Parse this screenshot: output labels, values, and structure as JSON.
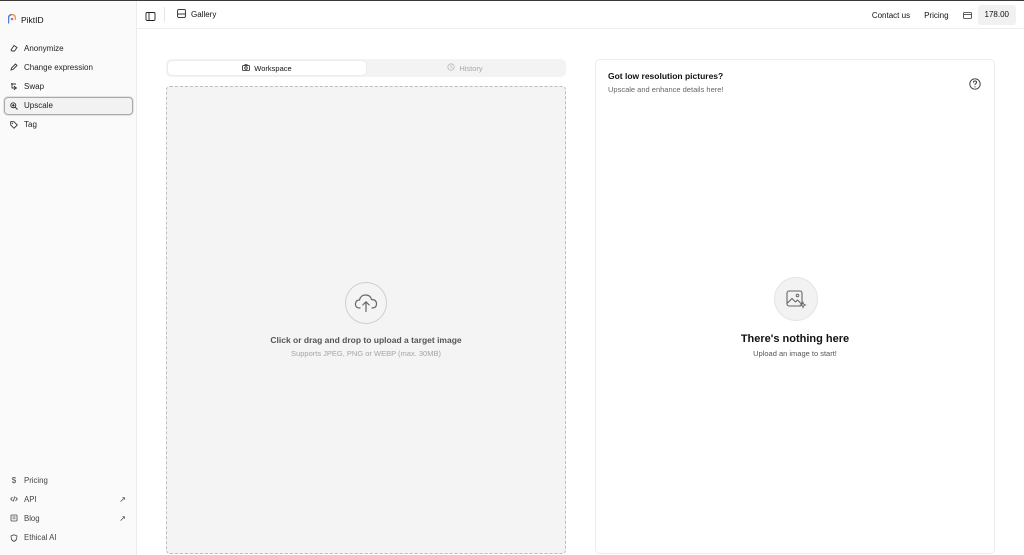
{
  "app": {
    "name": "PiktID"
  },
  "sidebar": {
    "items": [
      {
        "label": "Anonymize",
        "icon": "eraser-icon"
      },
      {
        "label": "Change expression",
        "icon": "pencil-icon"
      },
      {
        "label": "Swap",
        "icon": "swap-icon"
      },
      {
        "label": "Upscale",
        "icon": "zoom-in-icon",
        "active": true
      },
      {
        "label": "Tag",
        "icon": "tag-icon"
      }
    ],
    "bottom_items": [
      {
        "label": "Pricing",
        "icon": "dollar-icon"
      },
      {
        "label": "API",
        "icon": "code-icon",
        "external": "↗"
      },
      {
        "label": "Blog",
        "icon": "book-icon",
        "external": "↗"
      },
      {
        "label": "Ethical AI",
        "icon": "shield-icon"
      }
    ]
  },
  "topbar": {
    "gallery_label": "Gallery",
    "contact_label": "Contact us",
    "pricing_label": "Pricing",
    "credits_value": "178.00"
  },
  "tabs": [
    {
      "label": "Workspace",
      "icon": "camera-icon",
      "active": true
    },
    {
      "label": "History",
      "icon": "history-icon",
      "active": false
    }
  ],
  "dropzone": {
    "title": "Click or drag and drop to upload a target image",
    "subtitle": "Supports JPEG, PNG or WEBP (max. 30MB)"
  },
  "panel": {
    "title": "Got low resolution pictures?",
    "subtitle": "Upscale and enhance details here!",
    "empty_title": "There's nothing here",
    "empty_subtitle": "Upload an image to start!"
  },
  "colors": {
    "accent": "#111111",
    "brand_orange": "#f39c3a",
    "brand_blue": "#4a7fd6"
  }
}
